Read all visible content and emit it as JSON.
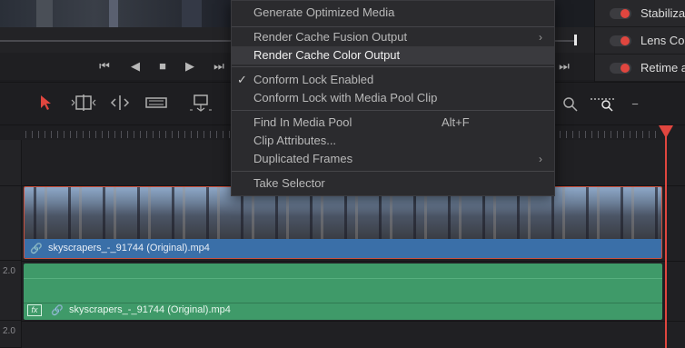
{
  "menu": {
    "items": [
      {
        "label": "Generate Optimized Media"
      },
      {
        "label": "Render Cache Fusion Output",
        "submenu": true
      },
      {
        "label": "Render Cache Color Output",
        "highlighted": true
      },
      {
        "label": "Conform Lock Enabled",
        "checked": true
      },
      {
        "label": "Conform Lock with Media Pool Clip"
      },
      {
        "label": "Find In Media Pool",
        "shortcut": "Alt+F"
      },
      {
        "label": "Clip Attributes..."
      },
      {
        "label": "Duplicated Frames",
        "submenu": true
      },
      {
        "label": "Take Selector"
      }
    ]
  },
  "inspector": {
    "rows": [
      {
        "label": "Stabilizati",
        "enabled": true
      },
      {
        "label": "Lens Corr",
        "enabled": true
      },
      {
        "label": "Retime a",
        "enabled": true
      }
    ]
  },
  "timeline": {
    "video_clip_name": "skyscrapers_-_91744 (Original).mp4",
    "audio_clip_name": "skyscrapers_-_91744 (Original).mp4",
    "audio_fx_badge": "fx",
    "track_labels": [
      "2.0",
      "2.0"
    ]
  },
  "colors": {
    "accent": "#e0463f",
    "video_clip": "#3a6fa8",
    "audio_clip": "#3f9a69"
  }
}
